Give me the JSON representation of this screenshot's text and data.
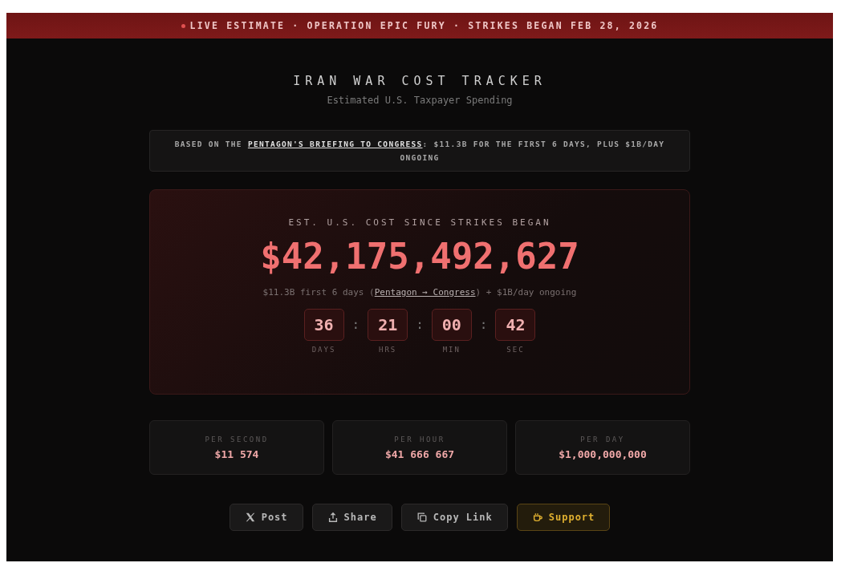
{
  "banner": {
    "live": true,
    "text": "LIVE ESTIMATE · OPERATION EPIC FURY · STRIKES BEGAN FEB 28, 2026"
  },
  "header": {
    "title": "IRAN WAR COST TRACKER",
    "subtitle": "Estimated U.S. Taxpayer Spending"
  },
  "notice": {
    "before": "BASED ON THE",
    "link": "PENTAGON'S BRIEFING TO CONGRESS",
    "after": ": $11.3B FOR THE FIRST 6 DAYS, PLUS $1B/DAY ONGOING"
  },
  "counter": {
    "label": "EST. U.S. COST SINCE STRIKES BEGAN",
    "amount": "$42,175,492,627",
    "note_before": "$11.3B first 6 days (",
    "note_link": "Pentagon → Congress",
    "note_after": ") + $1B/day ongoing",
    "units": [
      {
        "value": "36",
        "label": "DAYS"
      },
      {
        "value": "21",
        "label": "HRS"
      },
      {
        "value": "00",
        "label": "MIN"
      },
      {
        "value": "42",
        "label": "SEC"
      }
    ],
    "separator": ":"
  },
  "rates": [
    {
      "label": "PER SECOND",
      "value": "$11 574"
    },
    {
      "label": "PER HOUR",
      "value": "$41 666 667"
    },
    {
      "label": "PER DAY",
      "value": "$1,000,000,000"
    }
  ],
  "buttons": [
    {
      "label": "Post",
      "kind": "x"
    },
    {
      "label": "Share",
      "kind": "share"
    },
    {
      "label": "Copy Link",
      "kind": "copy"
    },
    {
      "label": "Support",
      "kind": "support"
    }
  ]
}
